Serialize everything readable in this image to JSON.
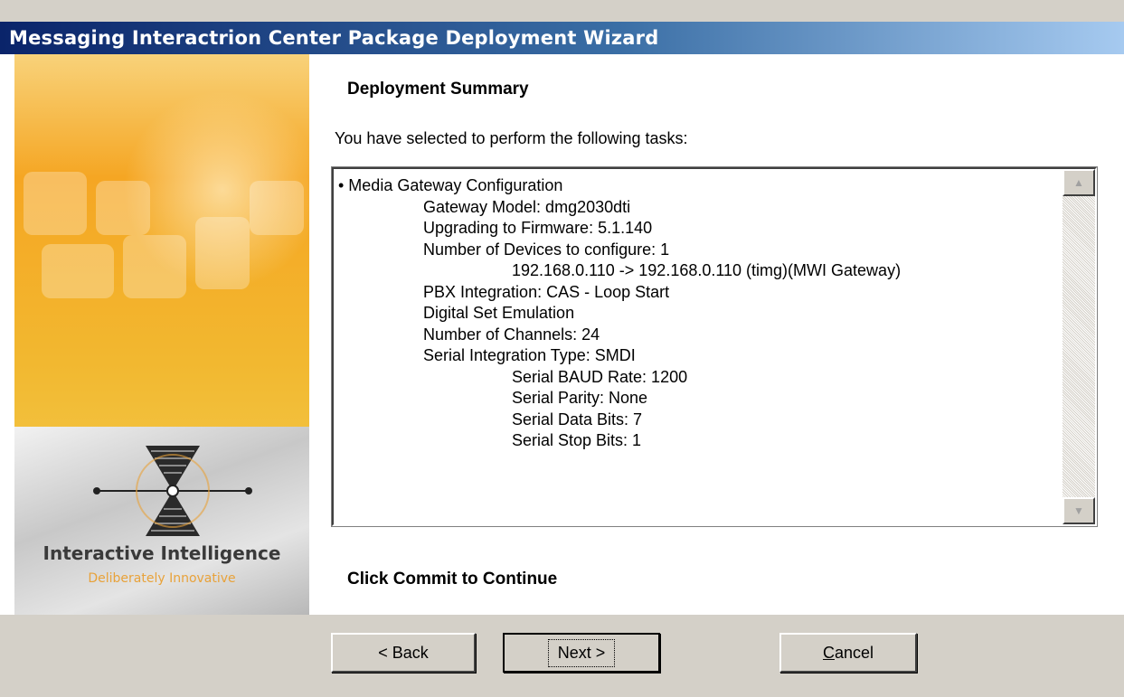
{
  "window": {
    "title": "Messaging Interactrion Center Package Deployment Wizard"
  },
  "banner": {
    "brand": "Interactive Intelligence",
    "tagline": "Deliberately Innovative"
  },
  "main": {
    "heading": "Deployment Summary",
    "intro": "You have selected to perform the following tasks:",
    "summary_lines": [
      "• Media Gateway Configuration",
      "Gateway Model: dmg2030dti",
      "Upgrading to Firmware: 5.1.140",
      "Number of Devices to configure: 1",
      "192.168.0.110 -> 192.168.0.110 (timg)(MWI Gateway)",
      "PBX Integration: CAS - Loop Start",
      "Digital Set Emulation",
      "Number of Channels: 24",
      "Serial Integration Type: SMDI",
      "Serial BAUD Rate: 1200",
      "Serial Parity: None",
      "Serial Data Bits: 7",
      "Serial Stop Bits: 1"
    ],
    "footer_note": "Click Commit to Continue"
  },
  "buttons": {
    "back": "< Back",
    "next": "Next >",
    "cancel_first": "C",
    "cancel_rest": "ancel"
  },
  "icons": {
    "scroll_up": "scroll-up-arrow-icon",
    "scroll_down": "scroll-down-arrow-icon",
    "logo": "interactive-intelligence-logo-icon"
  }
}
